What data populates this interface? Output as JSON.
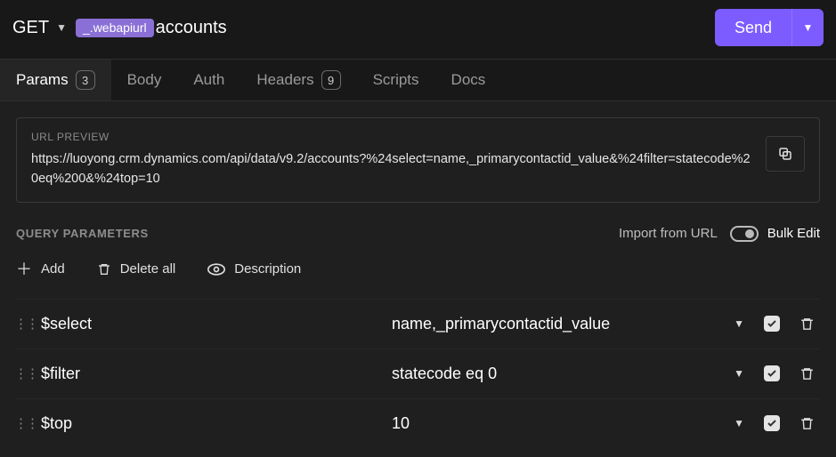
{
  "request": {
    "method": "GET",
    "var_pill": "_.webapiurl",
    "path_suffix": "accounts",
    "send_label": "Send"
  },
  "tabs": [
    {
      "label": "Params",
      "badge": "3",
      "active": true
    },
    {
      "label": "Body"
    },
    {
      "label": "Auth"
    },
    {
      "label": "Headers",
      "badge": "9"
    },
    {
      "label": "Scripts"
    },
    {
      "label": "Docs"
    }
  ],
  "url_preview": {
    "heading": "URL PREVIEW",
    "url": "https://luoyong.crm.dynamics.com/api/data/v9.2/accounts?%24select=name,_primarycontactid_value&%24filter=statecode%20eq%200&%24top=10"
  },
  "query_params": {
    "section_title": "QUERY PARAMETERS",
    "import_label": "Import from URL",
    "bulk_edit_label": "Bulk Edit",
    "toolbar": {
      "add_label": "Add",
      "delete_all_label": "Delete all",
      "description_label": "Description"
    },
    "rows": [
      {
        "key": "$select",
        "value": "name,_primarycontactid_value",
        "enabled": true
      },
      {
        "key": "$filter",
        "value": "statecode eq 0",
        "enabled": true
      },
      {
        "key": "$top",
        "value": "10",
        "enabled": true
      }
    ]
  }
}
